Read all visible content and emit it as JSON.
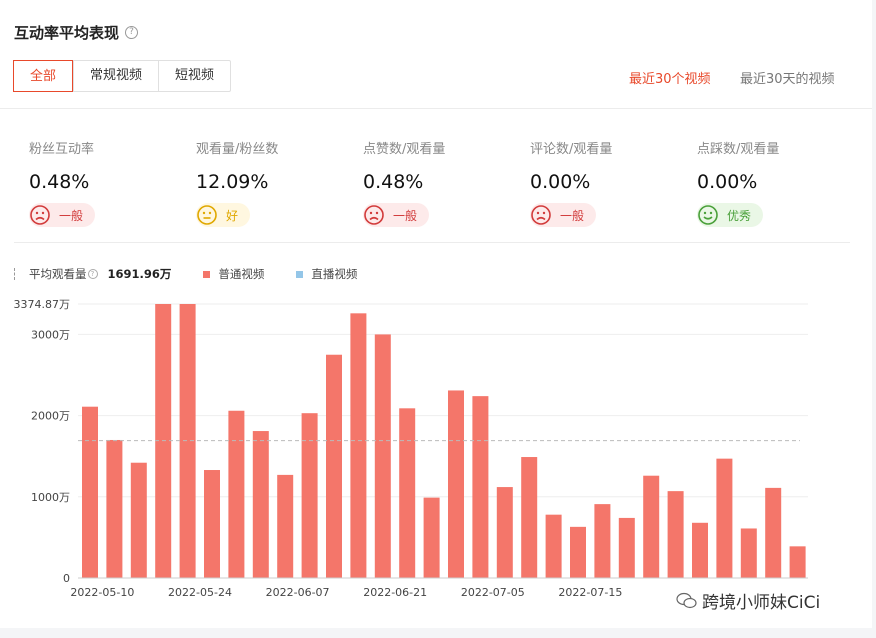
{
  "header": {
    "title": "互动率平均表现",
    "help": "?"
  },
  "tabs": [
    {
      "label": "全部",
      "active": true
    },
    {
      "label": "常规视频",
      "active": false
    },
    {
      "label": "短视频",
      "active": false
    }
  ],
  "ranges": {
    "recent30": "最近30个视频",
    "last30days": "最近30天的视频"
  },
  "metrics": [
    {
      "label": "粉丝互动率",
      "value": "0.48%",
      "badge": "一般",
      "level": "bad"
    },
    {
      "label": "观看量/粉丝数",
      "value": "12.09%",
      "badge": "好",
      "level": "good"
    },
    {
      "label": "点赞数/观看量",
      "value": "0.48%",
      "badge": "一般",
      "level": "bad"
    },
    {
      "label": "评论数/观看量",
      "value": "0.00%",
      "badge": "一般",
      "level": "bad"
    },
    {
      "label": "点踩数/观看量",
      "value": "0.00%",
      "badge": "优秀",
      "level": "great"
    }
  ],
  "legend": {
    "avg_label": "平均观看量",
    "avg_value": "1691.96万",
    "series1": "普通视频",
    "series2": "直播视频",
    "color1": "#f4766a",
    "color2": "#94c6e8"
  },
  "watermark": "跨境小师妹CiCi",
  "chart_data": {
    "type": "bar",
    "ylim": [
      0,
      3374.87
    ],
    "yticks": [
      0,
      1000,
      2000,
      3000,
      3374.87
    ],
    "ytick_labels": [
      "0",
      "1000万",
      "2000万",
      "3000万",
      "3374.87万"
    ],
    "average": 1691.96,
    "xtick_labels": [
      "2022-05-10",
      "2022-05-24",
      "2022-06-07",
      "2022-06-21",
      "2022-07-05",
      "2022-07-15"
    ],
    "xtick_index": [
      1,
      5,
      9,
      13,
      17,
      21
    ],
    "series": [
      {
        "name": "普通视频",
        "color": "#f4766a",
        "values": [
          2110,
          1700,
          1420,
          3374.87,
          3374.87,
          1330,
          2060,
          1810,
          1270,
          2030,
          2750,
          3260,
          3000,
          2090,
          990,
          2310,
          2240,
          1120,
          1490,
          780,
          630,
          910,
          740,
          1260,
          1070,
          680,
          1470,
          610,
          1110,
          390
        ]
      },
      {
        "name": "直播视频",
        "color": "#94c6e8",
        "values": []
      }
    ]
  }
}
